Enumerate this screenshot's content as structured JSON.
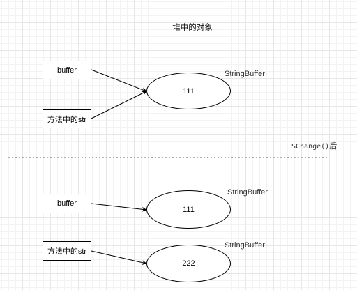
{
  "heap_title": "堆中的对象",
  "top_section": {
    "box_buffer": "buffer",
    "box_method_str": "方法中的str",
    "object_value": "111",
    "object_type": "StringBuffer"
  },
  "divider_label": {
    "method_name": "SChange()",
    "suffix": "后"
  },
  "bottom_section": {
    "box_buffer": "buffer",
    "box_method_str": "方法中的str",
    "object1_value": "111",
    "object1_type": "StringBuffer",
    "object2_value": "222",
    "object2_type": "StringBuffer"
  },
  "colors": {
    "stroke": "#000000",
    "divider": "#666666",
    "grid": "#e6e6e6"
  }
}
